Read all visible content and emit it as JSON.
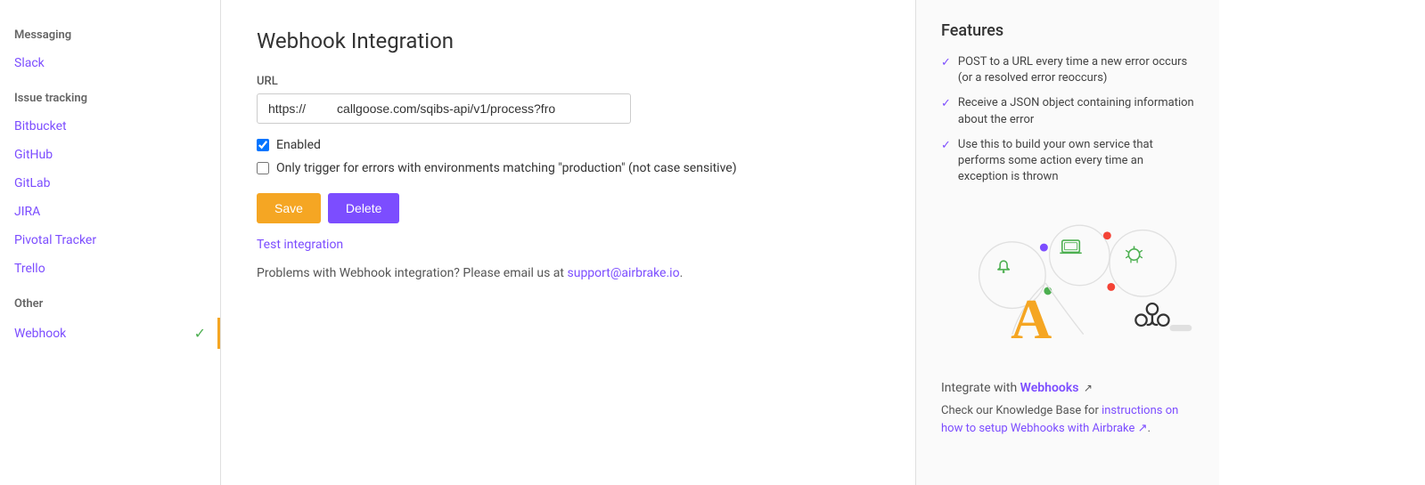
{
  "sidebar": {
    "messaging_label": "Messaging",
    "slack_label": "Slack",
    "issue_tracking_label": "Issue tracking",
    "bitbucket_label": "Bitbucket",
    "github_label": "GitHub",
    "gitlab_label": "GitLab",
    "jira_label": "JIRA",
    "pivotal_tracker_label": "Pivotal Tracker",
    "trello_label": "Trello",
    "other_label": "Other",
    "webhook_label": "Webhook"
  },
  "main": {
    "title": "Webhook Integration",
    "url_label": "URL",
    "url_value": "https://         callgoose.com/sqibs-api/v1/process?fro",
    "enabled_label": "Enabled",
    "only_trigger_label": "Only trigger for errors with environments matching \"production\" (not case sensitive)",
    "save_label": "Save",
    "delete_label": "Delete",
    "test_integration_label": "Test integration",
    "problems_text": "Problems with Webhook integration? Please email us at",
    "support_email": "support@airbrake.io"
  },
  "features": {
    "title": "Features",
    "items": [
      "POST to a URL every time a new error occurs (or a resolved error reoccurs)",
      "Receive a JSON object containing information about the error",
      "Use this to build your own service that performs some action every time an exception is thrown"
    ],
    "integrate_label": "Integrate with",
    "integrate_link": "Webhooks",
    "knowledge_base_prefix": "Check our Knowledge Base for",
    "knowledge_base_link": "instructions on how to setup Webhooks with Airbrake",
    "ext_icon": "↗"
  },
  "colors": {
    "accent": "#7c4dff",
    "orange": "#f5a623",
    "green": "#4caf50"
  }
}
